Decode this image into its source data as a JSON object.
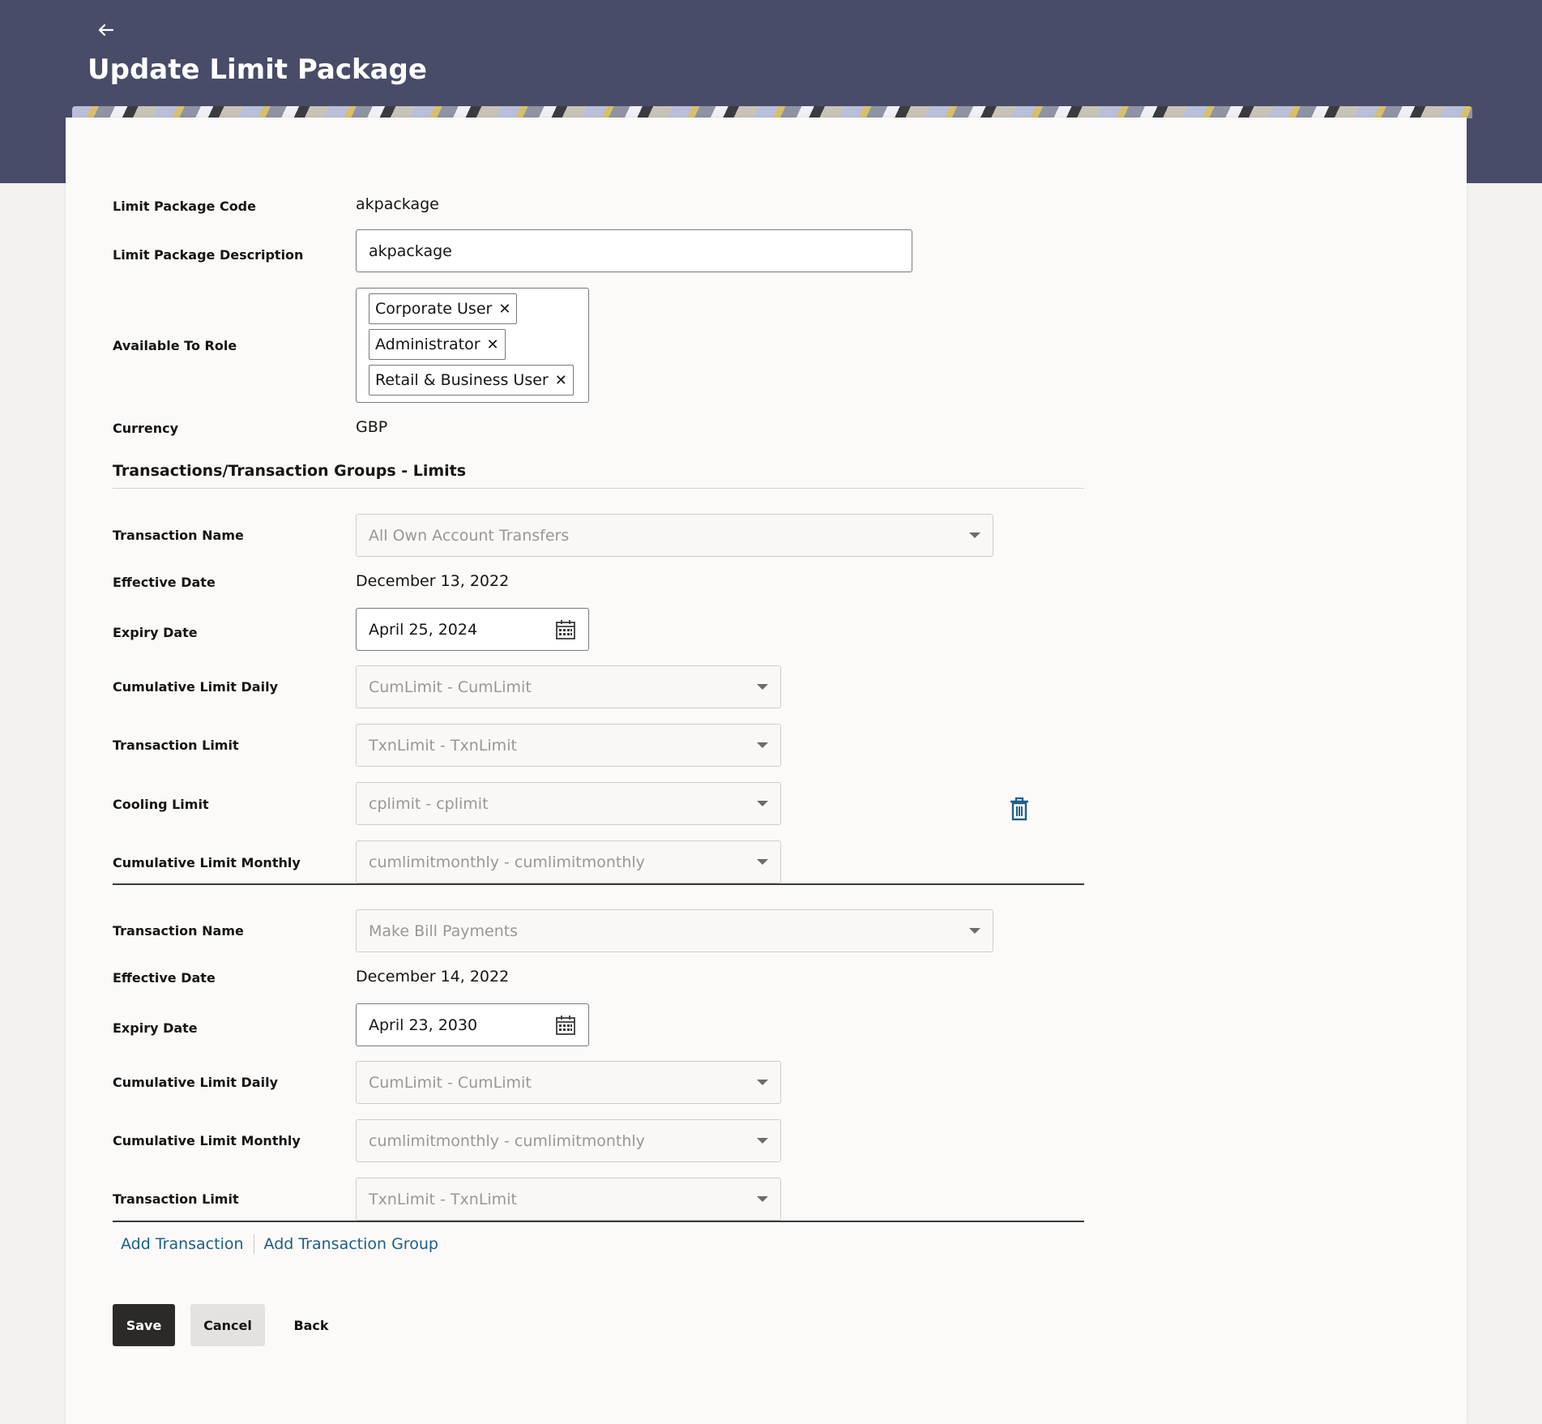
{
  "header": {
    "back_icon": "arrow-left-icon",
    "title": "Update Limit Package"
  },
  "package": {
    "code_label": "Limit Package Code",
    "code_value": "akpackage",
    "description_label": "Limit Package Description",
    "description_value": "akpackage",
    "roles_label": "Available To Role",
    "roles": [
      "Corporate User",
      "Administrator",
      "Retail & Business User"
    ],
    "currency_label": "Currency",
    "currency_value": "GBP"
  },
  "section_title": "Transactions/Transaction Groups - Limits",
  "tx1": {
    "name_label": "Transaction Name",
    "name_value": "All Own Account Transfers",
    "effective_label": "Effective Date",
    "effective_value": "December 13, 2022",
    "expiry_label": "Expiry Date",
    "expiry_value": "April 25, 2024",
    "cum_daily_label": "Cumulative Limit Daily",
    "cum_daily_value": "CumLimit - CumLimit",
    "txn_limit_label": "Transaction Limit",
    "txn_limit_value": "TxnLimit - TxnLimit",
    "cooling_label": "Cooling Limit",
    "cooling_value": "cplimit - cplimit",
    "cum_monthly_label": "Cumulative Limit Monthly",
    "cum_monthly_value": "cumlimitmonthly - cumlimitmonthly"
  },
  "tx2": {
    "name_label": "Transaction Name",
    "name_value": "Make Bill Payments",
    "effective_label": "Effective Date",
    "effective_value": "December 14, 2022",
    "expiry_label": "Expiry Date",
    "expiry_value": "April 23, 2030",
    "cum_daily_label": "Cumulative Limit Daily",
    "cum_daily_value": "CumLimit - CumLimit",
    "cum_monthly_label": "Cumulative Limit Monthly",
    "cum_monthly_value": "cumlimitmonthly - cumlimitmonthly",
    "txn_limit_label": "Transaction Limit",
    "txn_limit_value": "TxnLimit - TxnLimit"
  },
  "links": {
    "add_transaction": "Add Transaction",
    "add_transaction_group": "Add Transaction Group"
  },
  "buttons": {
    "save": "Save",
    "cancel": "Cancel",
    "back": "Back"
  },
  "colors": {
    "banner": "#484c68",
    "link": "#1d6089",
    "primary_button": "#2b2a28"
  }
}
